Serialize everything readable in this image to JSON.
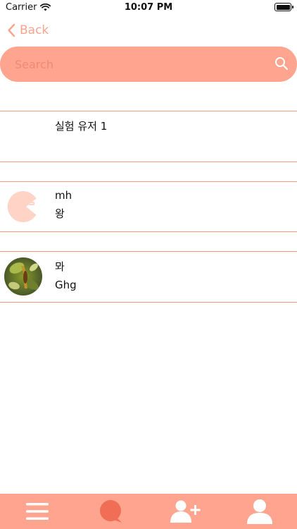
{
  "status_bar": {
    "carrier": "Carrier",
    "time": "10:07 PM"
  },
  "nav": {
    "back_label": "Back"
  },
  "search": {
    "placeholder": "Search",
    "value": ""
  },
  "list": {
    "items": [
      {
        "title": "실험 유저 1",
        "subtitle": ""
      },
      {
        "title": "mh",
        "subtitle": "왕"
      },
      {
        "title": "뫄",
        "subtitle": "Ghg"
      }
    ]
  },
  "tab_bar": {
    "tabs": [
      "menu-icon",
      "chat-bubble-icon",
      "add-friend-icon",
      "profile-icon"
    ]
  },
  "colors": {
    "accent": "#ffa48f",
    "accent_dark": "#f06e55",
    "back": "#f7a48c",
    "separator": "#f39b86"
  }
}
